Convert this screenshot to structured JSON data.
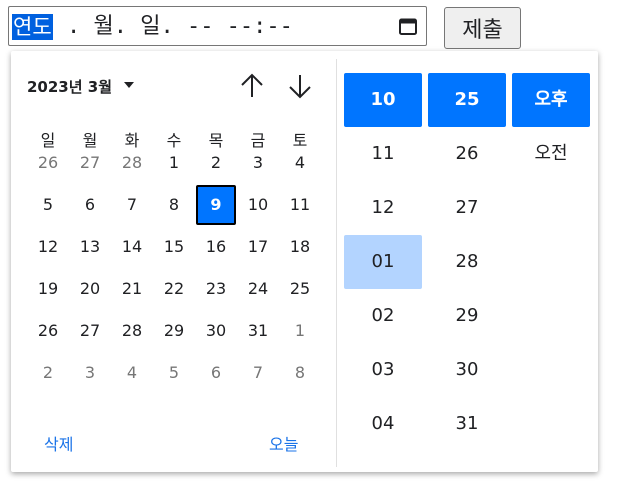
{
  "input": {
    "year_seg": "연도",
    "rest": ". 월. 일. -- --:--",
    "calendar_icon": "calendar-icon"
  },
  "submit_label": "제출",
  "calendar": {
    "month_label": "2023년 3월",
    "weekdays": [
      "일",
      "월",
      "화",
      "수",
      "목",
      "금",
      "토"
    ],
    "weeks": [
      [
        {
          "d": "26",
          "o": true
        },
        {
          "d": "27",
          "o": true
        },
        {
          "d": "28",
          "o": true
        },
        {
          "d": "1"
        },
        {
          "d": "2"
        },
        {
          "d": "3"
        },
        {
          "d": "4"
        }
      ],
      [
        {
          "d": "5"
        },
        {
          "d": "6"
        },
        {
          "d": "7"
        },
        {
          "d": "8"
        },
        {
          "d": "9",
          "sel": true
        },
        {
          "d": "10"
        },
        {
          "d": "11"
        }
      ],
      [
        {
          "d": "12"
        },
        {
          "d": "13"
        },
        {
          "d": "14"
        },
        {
          "d": "15"
        },
        {
          "d": "16"
        },
        {
          "d": "17"
        },
        {
          "d": "18"
        }
      ],
      [
        {
          "d": "19"
        },
        {
          "d": "20"
        },
        {
          "d": "21"
        },
        {
          "d": "22"
        },
        {
          "d": "23"
        },
        {
          "d": "24"
        },
        {
          "d": "25"
        }
      ],
      [
        {
          "d": "26"
        },
        {
          "d": "27"
        },
        {
          "d": "28"
        },
        {
          "d": "29"
        },
        {
          "d": "30"
        },
        {
          "d": "31"
        },
        {
          "d": "1",
          "o": true
        }
      ],
      [
        {
          "d": "2",
          "o": true
        },
        {
          "d": "3",
          "o": true
        },
        {
          "d": "4",
          "o": true
        },
        {
          "d": "5",
          "o": true
        },
        {
          "d": "6",
          "o": true
        },
        {
          "d": "7",
          "o": true
        },
        {
          "d": "8",
          "o": true
        }
      ]
    ],
    "clear_label": "삭제",
    "today_label": "오늘",
    "accent": "#0075ff"
  },
  "time": {
    "hours": [
      {
        "v": "10",
        "sel": true
      },
      {
        "v": "11"
      },
      {
        "v": "12"
      },
      {
        "v": "01",
        "hover": true
      },
      {
        "v": "02"
      },
      {
        "v": "03"
      },
      {
        "v": "04"
      }
    ],
    "minutes": [
      {
        "v": "25",
        "sel": true
      },
      {
        "v": "26"
      },
      {
        "v": "27"
      },
      {
        "v": "28"
      },
      {
        "v": "29"
      },
      {
        "v": "30"
      },
      {
        "v": "31"
      }
    ],
    "ampm": [
      {
        "v": "오후",
        "sel": true
      },
      {
        "v": "오전"
      }
    ]
  }
}
